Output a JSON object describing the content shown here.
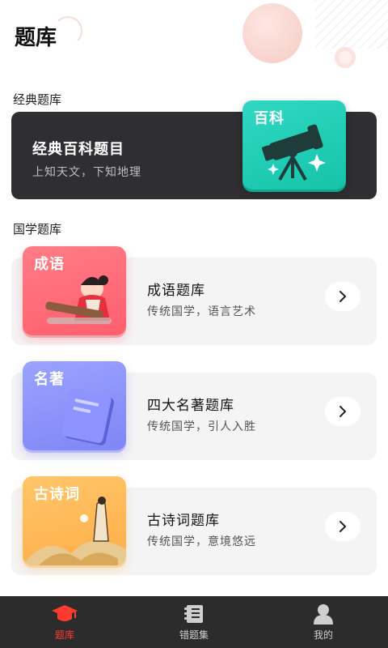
{
  "header": {
    "title": "题库"
  },
  "sections": {
    "classic": {
      "title": "经典题库"
    },
    "guoxue": {
      "title": "国学题库"
    }
  },
  "classic_card": {
    "title": "经典百科题目",
    "subtitle": "上知天文，下知地理",
    "tile_label": "百科",
    "icon": "telescope-icon"
  },
  "list": [
    {
      "tile_label": "成语",
      "title": "成语题库",
      "subtitle": "传统国学，语言艺术",
      "icon": "scholar-guqin-illustration",
      "color": "#ff6270"
    },
    {
      "tile_label": "名著",
      "title": "四大名著题库",
      "subtitle": "传统国学，引人入胜",
      "icon": "book-icon",
      "color": "#858cf8"
    },
    {
      "tile_label": "古诗词",
      "title": "古诗词题库",
      "subtitle": "传统国学，意境悠远",
      "icon": "poet-mountain-illustration",
      "color": "#ffb24f"
    }
  ],
  "nav": {
    "items": [
      {
        "label": "题库",
        "icon": "graduation-cap-icon",
        "active": true
      },
      {
        "label": "错题集",
        "icon": "notebook-list-icon",
        "active": false
      },
      {
        "label": "我的",
        "icon": "user-icon",
        "active": false
      }
    ],
    "colors": {
      "active": "#ff3b30",
      "inactive": "#cfcfcf",
      "bar": "#2c2c2c"
    }
  }
}
